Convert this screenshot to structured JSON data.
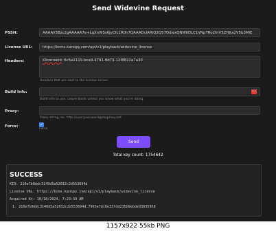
{
  "page": {
    "title": "Send Widevine Request"
  },
  "form": {
    "pssh_label": "PSSH:",
    "pssh_value": "AAAAV3Bzc2gAAAAA7e+LqXnWSs6jyCfc1R0h7QAAADcIARIQ2Q57DdwxQNWIIDLC1VNpTRoLYnV5ZHJta2V5b3MiE",
    "license_url_label": "License URL:",
    "license_url_value": "https://kcms.kanopy.com/api/v1/playback/widevine_license",
    "headers_label": "Headers:",
    "headers_value_key": "Kliceneeid",
    "headers_value_rest": ": 6c5a2119-bca9-4791-8d79-12f8822a7a30",
    "headers_help": "Headers that are sent to the license server.",
    "build_info_label": "Build Info:",
    "build_info_value": "",
    "build_info_help": "Build info to use. Leave blank unless you know what you're doing.",
    "proxy_label": "Proxy:",
    "proxy_value": "",
    "proxy_help": "Proxy string, ex: http://user:password@myproxy.net",
    "force_label": "Force:",
    "force_checked": true,
    "force_note": "Force",
    "send_label": "Send",
    "total_key_count": "Total key count: 1754642"
  },
  "result": {
    "title": "SUCCESS",
    "kid_line": "KID: 210e7b0ddc3140d5a52032c2d553694d",
    "license_url_line": "License URL: https://kcms.kanopy.com/api/v1/playback/widevine_license",
    "acquired_line": "Acquired At: 10/18/2024, 7:23:39 AM",
    "keys": [
      "1. 210e7b0ddc3140d5a52032c2d553694d:7965e7dc6e33fdd235b9ebde93935958"
    ]
  },
  "footer": {
    "caption": "1157x922  55kb  PNG"
  },
  "colors": {
    "background": "#1b1b1b",
    "accent": "#7c4dff",
    "checkbox": "#3b82f6",
    "error_badge": "#e53935"
  }
}
